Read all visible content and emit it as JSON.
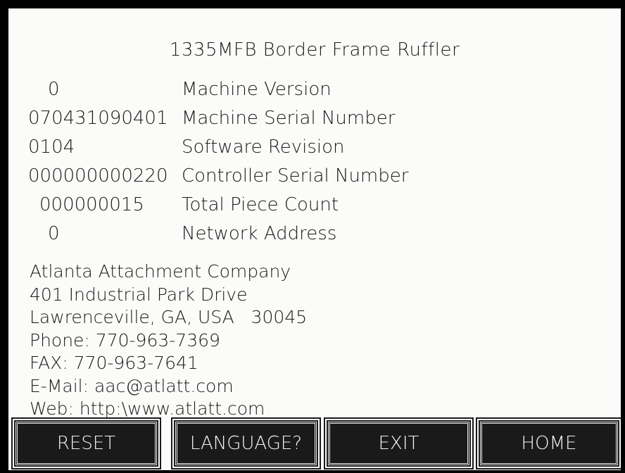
{
  "title": "1335MFB Border Frame Ruffler",
  "info_rows": [
    {
      "value": "0",
      "label": "Machine Version"
    },
    {
      "value": "070431090401",
      "label": "Machine Serial Number"
    },
    {
      "value": "0104",
      "label": "Software Revision"
    },
    {
      "value": "000000000220",
      "label": "Controller Serial Number"
    },
    {
      "value": "000000015",
      "label": "Total Piece Count"
    },
    {
      "value": "0",
      "label": "Network Address"
    }
  ],
  "company": {
    "name": "Atlanta Attachment Company",
    "street": "401 Industrial Park Drive",
    "city": "Lawrenceville, GA, USA   30045",
    "phone": "Phone: 770-963-7369",
    "fax": "FAX: 770-963-7641",
    "email": "E-Mail: aac@atlatt.com",
    "web": "Web: http:\\www.atlatt.com"
  },
  "buttons": {
    "reset": "RESET",
    "language": "LANGUAGE?",
    "exit": "EXIT",
    "home": "HOME"
  },
  "colors": {
    "screen_bg": "#fbfbf9",
    "text": "#1b1b1b",
    "button_bg": "#1a1a1a",
    "button_text": "#f4f4f4"
  }
}
